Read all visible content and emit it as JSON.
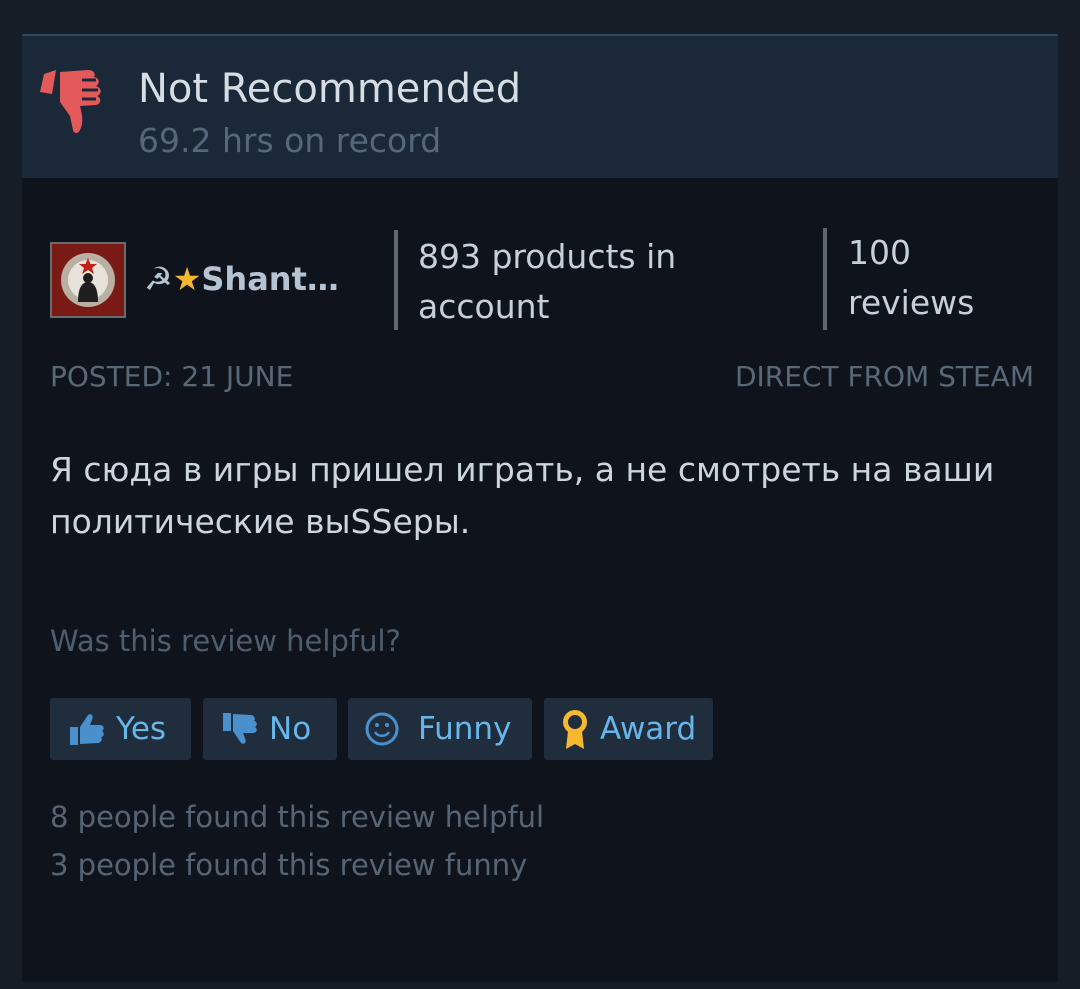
{
  "review": {
    "verdict": "Not Recommended",
    "hours": "69.2 hrs on record"
  },
  "author": {
    "prefix": "☭",
    "star": "★",
    "name": "Shant…",
    "products": "893 products in account",
    "products_line1": "893 products in",
    "products_line2": "account",
    "reviews_line1": "100",
    "reviews_line2": "reviews"
  },
  "meta": {
    "posted": "POSTED: 21 JUNE",
    "source": "DIRECT FROM STEAM"
  },
  "content": {
    "text": "Я сюда в игры пришел играть, а не смотреть на ваши политические выSSеры."
  },
  "feedback": {
    "question": "Was this review helpful?",
    "buttons": {
      "yes": "Yes",
      "no": "No",
      "funny": "Funny",
      "award": "Award"
    },
    "helpful_count": "8 people found this review helpful",
    "funny_count": "3 people found this review funny"
  },
  "icons": {
    "verdict": "thumbs-down-icon",
    "yes": "thumbs-up-icon",
    "no": "thumbs-down-icon",
    "funny": "smiley-icon",
    "award": "award-ribbon-icon"
  },
  "colors": {
    "not_recommended": "#e45a5a",
    "button_text": "#67b6ea",
    "award_gold": "#f5b82e"
  }
}
